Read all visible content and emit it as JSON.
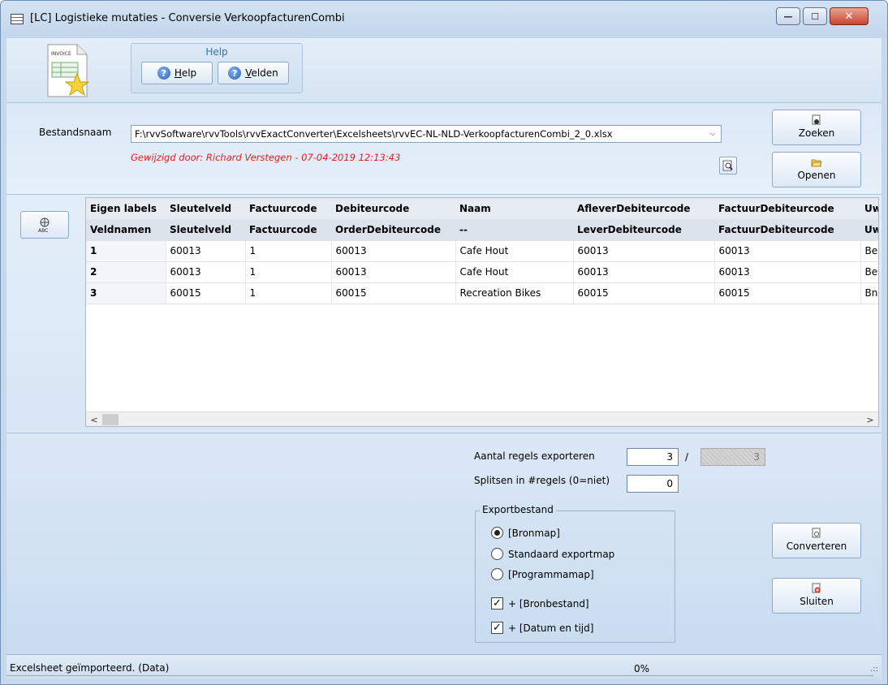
{
  "window": {
    "title": "[LC]  Logistieke mutaties - Conversie VerkoopfacturenCombi",
    "controls": {
      "minimize": "—",
      "maximize": "☐",
      "close": "✕"
    }
  },
  "toolbar": {
    "doc_icon_text": "INVOICE",
    "help_group_title": "Help",
    "help_button": {
      "accel": "H",
      "rest": "elp"
    },
    "fields_button": {
      "accel": "V",
      "rest": "elden"
    }
  },
  "file": {
    "label": "Bestandsnaam",
    "path": "F:\\rvvSoftware\\rvvTools\\rvvExactConverter\\Excelsheets\\rvvEC-NL-NLD-VerkoopfacturenCombi_2_0.xlsx",
    "modified": "Gewijzigd door: Richard Verstegen   -   07-04-2019  12:13:43",
    "search_button": {
      "accel": "Z",
      "rest": "oeken"
    },
    "open_button": {
      "accel": "O",
      "rest": "penen"
    }
  },
  "grid": {
    "header_labels": [
      "Eigen labels",
      "Sleutelveld",
      "Factuurcode",
      "Debiteurcode",
      "Naam",
      "AfleverDebiteurcode",
      "FactuurDebiteurcode",
      "Uw"
    ],
    "header_fields": [
      "Veldnamen",
      "Sleutelveld",
      "Factuurcode",
      "OrderDebiteurcode",
      "--",
      "LeverDebiteurcode",
      "FactuurDebiteurcode",
      "Uw"
    ],
    "rows": [
      [
        "1",
        "60013",
        "1",
        "60013",
        "Cafe Hout",
        "60013",
        "60013",
        "Bes"
      ],
      [
        "2",
        "60013",
        "1",
        "60013",
        "Cafe Hout",
        "60013",
        "60013",
        "Bes"
      ],
      [
        "3",
        "60015",
        "1",
        "60015",
        "Recreation Bikes",
        "60015",
        "60015",
        "Bnr"
      ]
    ],
    "scroll_left": "<",
    "scroll_right": ">"
  },
  "export": {
    "rows_label": "Aantal regels exporteren",
    "rows_value": "3",
    "rows_separator": "/",
    "rows_total": "3",
    "split_label": "Splitsen in #regels (0=niet)",
    "split_value": "0",
    "group_title": "Exportbestand",
    "options": [
      "[Bronmap]",
      "Standaard exportmap",
      "[Programmamap]"
    ],
    "selected_option": 0,
    "checks": [
      "+ [Bronbestand]",
      "+ [Datum en tijd]"
    ],
    "check_mark": "✓",
    "convert_button": {
      "accel": "C",
      "rest": "onverteren"
    },
    "close_button": {
      "accel": "S",
      "rest": "luiten"
    }
  },
  "status": {
    "text": "Excelsheet geïmporteerd. (Data)",
    "progress": "0%",
    "grip": ".::"
  }
}
